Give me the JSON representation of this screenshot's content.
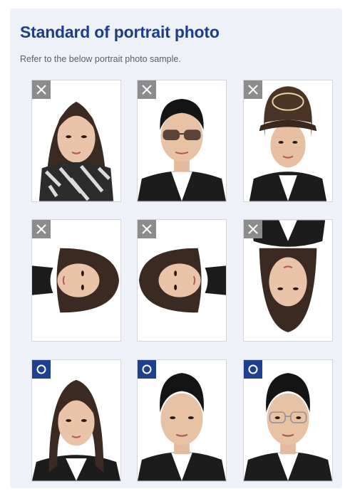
{
  "header": {
    "title": "Standard of portrait photo",
    "subtitle": "Refer to the below portrait photo sample."
  },
  "colors": {
    "title": "#1c3d8a",
    "bad_badge": "#8c8c8c",
    "good_badge": "#1f3f8f",
    "panel_bg": "#eef1f7"
  },
  "samples": [
    {
      "status": "rejected",
      "badge_icon": "x-mark-icon",
      "subject": "woman wearing patterned scarf"
    },
    {
      "status": "rejected",
      "badge_icon": "x-mark-icon",
      "subject": "man wearing sunglasses"
    },
    {
      "status": "rejected",
      "badge_icon": "x-mark-icon",
      "subject": "woman wearing baseball cap"
    },
    {
      "status": "rejected",
      "badge_icon": "x-mark-icon",
      "subject": "photo rotated left"
    },
    {
      "status": "rejected",
      "badge_icon": "x-mark-icon",
      "subject": "photo rotated right"
    },
    {
      "status": "rejected",
      "badge_icon": "x-mark-icon",
      "subject": "photo upside down"
    },
    {
      "status": "accepted",
      "badge_icon": "o-mark-icon",
      "subject": "woman correct portrait"
    },
    {
      "status": "accepted",
      "badge_icon": "o-mark-icon",
      "subject": "man correct portrait"
    },
    {
      "status": "accepted",
      "badge_icon": "o-mark-icon",
      "subject": "man with glasses correct portrait"
    }
  ]
}
